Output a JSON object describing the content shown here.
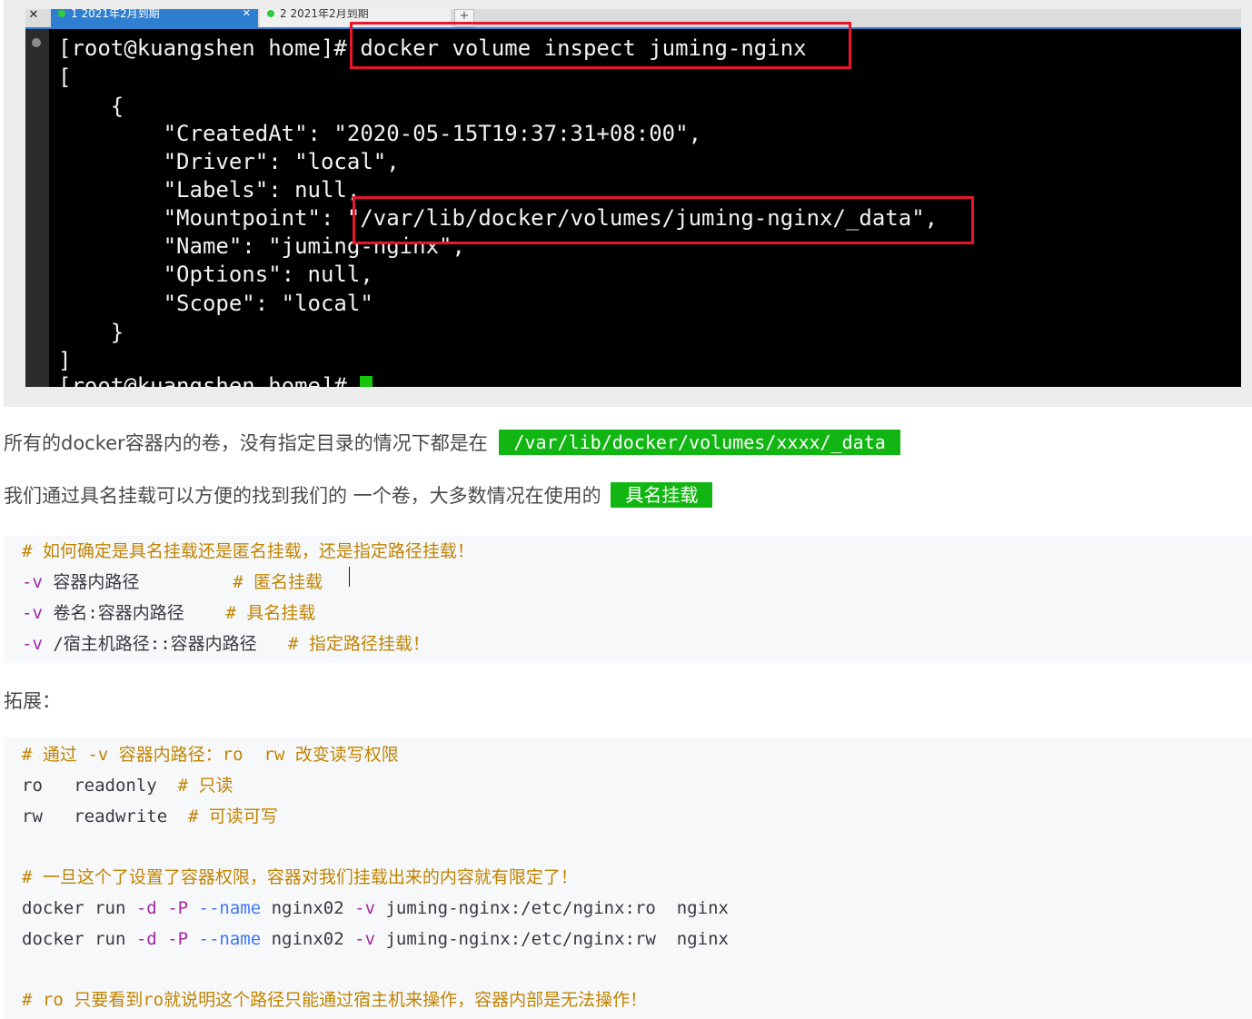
{
  "terminal": {
    "tabs": [
      {
        "label": "1 2021年2月到期",
        "active": true
      },
      {
        "label": "2 2021年2月到期",
        "active": false
      }
    ],
    "lines": [
      "[root@kuangshen home]# docker volume inspect juming-nginx",
      "[",
      "    {",
      "        \"CreatedAt\": \"2020-05-15T19:37:31+08:00\",",
      "        \"Driver\": \"local\",",
      "        \"Labels\": null,",
      "        \"Mountpoint\": \"/var/lib/docker/volumes/juming-nginx/_data\",",
      "        \"Name\": \"juming-nginx\",",
      "        \"Options\": null,",
      "        \"Scope\": \"local\"",
      "    }",
      "]",
      "[root@kuangshen home]# "
    ]
  },
  "article": {
    "p1_text": "所有的docker容器内的卷，没有指定目录的情况下都是在",
    "p1_code": "/var/lib/docker/volumes/xxxx/_data",
    "p2_text": "我们通过具名挂载可以方便的找到我们的 一个卷，大多数情况在使用的",
    "p2_code": "具名挂载",
    "heading_ext": "拓展："
  },
  "code1": {
    "comment": "# 如何确定是具名挂载还是匿名挂载，还是指定路径挂载！",
    "flag": "-v",
    "r1_arg": " 容器内路径         ",
    "r1_cmt": "# 匿名挂载",
    "r2_arg": " 卷名:容器内路径    ",
    "r2_cmt": "# 具名挂载",
    "r3_arg": " /宿主机路径::容器内路径   ",
    "r3_cmt": "# 指定路径挂载！"
  },
  "code2": {
    "c1": "# 通过 -v 容器内路径：ro  rw 改变读写权限",
    "ro_line": "ro   readonly  ",
    "ro_cmt": "# 只读",
    "rw_line": "rw   readwrite  ",
    "rw_cmt": "# 可读可写",
    "c2": "# 一旦这个了设置了容器权限，容器对我们挂载出来的内容就有限定了！",
    "cmd": "docker run ",
    "d": "-d",
    "P": "-P",
    "name": "--name",
    "n1": " nginx02 ",
    "v": "-v",
    "path_ro": " juming-nginx:/etc/nginx:ro  nginx",
    "path_rw": " juming-nginx:/etc/nginx:rw  nginx",
    "c3": "# ro 只要看到ro就说明这个路径只能通过宿主机来操作，容器内部是无法操作！"
  }
}
